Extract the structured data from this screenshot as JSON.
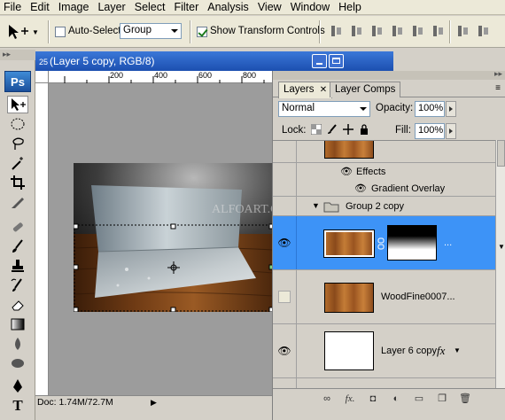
{
  "menu": [
    "File",
    "Edit",
    "Image",
    "Layer",
    "Select",
    "Filter",
    "Analysis",
    "View",
    "Window",
    "Help"
  ],
  "options": {
    "auto_select_label": "Auto-Select:",
    "auto_select_checked": false,
    "auto_select_value": "Group",
    "show_transform_label": "Show Transform Controls",
    "show_transform_checked": true
  },
  "document": {
    "title": "(Layer 5 copy, RGB/8)",
    "ruler_ticks": [
      "200",
      "400",
      "600",
      "800"
    ],
    "status": "Doc: 1.74M/72.7M",
    "watermark": "ALFOART.COM"
  },
  "layers_panel": {
    "tabs": [
      "Layers",
      "Layer Comps"
    ],
    "blend_mode": "Normal",
    "opacity_label": "Opacity:",
    "opacity_value": "100%",
    "lock_label": "Lock:",
    "fill_label": "Fill:",
    "fill_value": "100%",
    "effects_label": "Effects",
    "gradient_overlay_label": "Gradient Overlay",
    "group_label": "Group 2 copy",
    "layer_woodfine": "WoodFine0007...",
    "layer_6_copy": "Layer 6 copy",
    "fx_symbol": "fx"
  },
  "colors": {
    "selection": "#3d93f7",
    "title_blue": "#1c4fb0",
    "chrome": "#d4d0c8"
  }
}
